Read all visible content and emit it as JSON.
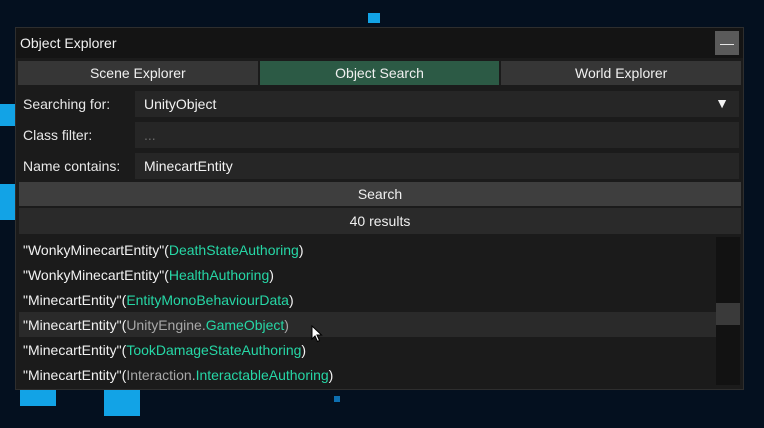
{
  "window": {
    "title": "Object Explorer",
    "minimize_label": "—"
  },
  "tabs": [
    {
      "label": "Scene Explorer",
      "active": false
    },
    {
      "label": "Object Search",
      "active": true
    },
    {
      "label": "World Explorer",
      "active": false
    }
  ],
  "form": {
    "searching_for": {
      "label": "Searching for:",
      "value": "UnityObject",
      "arrow": "▼"
    },
    "class_filter": {
      "label": "Class filter:",
      "placeholder": "..."
    },
    "name_contains": {
      "label": "Name contains:",
      "value": "MinecartEntity"
    }
  },
  "search_button": "Search",
  "results_count": "40 results",
  "results": [
    {
      "name": "\"WonkyMinecartEntity\"",
      "open": " (",
      "ns": "",
      "dot": "",
      "type": "DeathStateAuthoring",
      "close": ")"
    },
    {
      "name": "\"WonkyMinecartEntity\"",
      "open": " (",
      "ns": "",
      "dot": "",
      "type": "HealthAuthoring",
      "close": ")"
    },
    {
      "name": "\"MinecartEntity\"",
      "open": " (",
      "ns": "",
      "dot": "",
      "type": "EntityMonoBehaviourData",
      "close": ")"
    },
    {
      "name": "\"MinecartEntity\"",
      "open": " (",
      "ns": "UnityEngine",
      "dot": ".",
      "type": "GameObject",
      "close": ")"
    },
    {
      "name": "\"MinecartEntity\"",
      "open": " (",
      "ns": "",
      "dot": "",
      "type": "TookDamageStateAuthoring",
      "close": ")"
    },
    {
      "name": "\"MinecartEntity\"",
      "open": " (",
      "ns": "Interaction",
      "dot": ".",
      "type": "InteractableAuthoring",
      "close": ")"
    }
  ],
  "colors": {
    "active_tab": "#2c5a45",
    "type_text": "#26d7a6",
    "namespace_text": "#a8a8a8"
  }
}
